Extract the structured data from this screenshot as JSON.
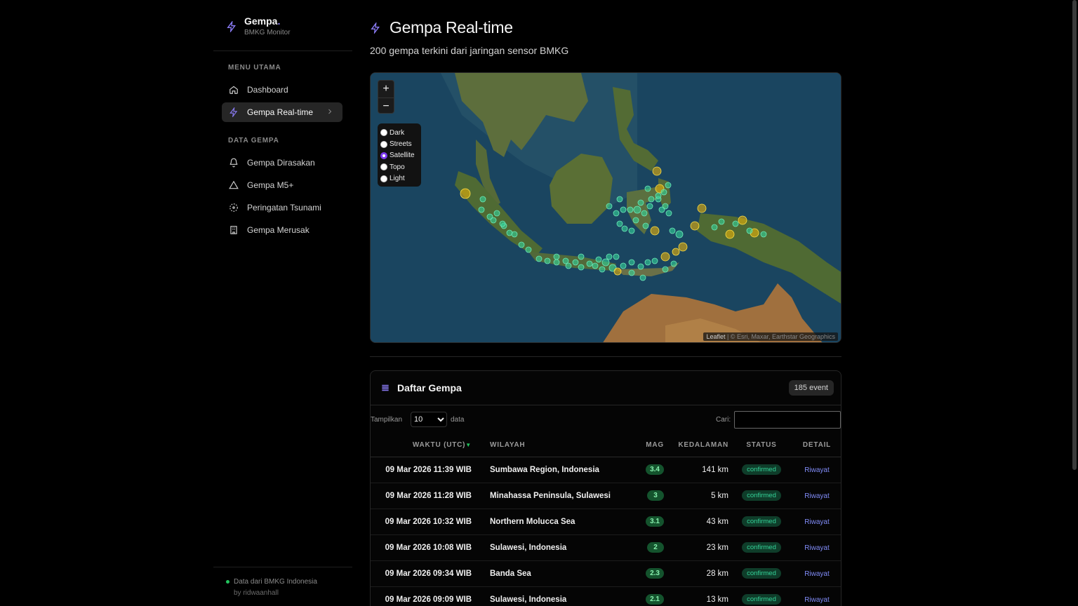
{
  "brand": {
    "title": "Gempa",
    "title_dot": ".",
    "subtitle": "BMKG Monitor"
  },
  "sidebar": {
    "section_main": "MENU UTAMA",
    "section_data": "DATA GEMPA",
    "items": [
      {
        "label": "Dashboard",
        "icon": "home-icon"
      },
      {
        "label": "Gempa Real-time",
        "icon": "bolt-icon",
        "active": true
      },
      {
        "label": "Gempa Dirasakan",
        "icon": "bell-icon"
      },
      {
        "label": "Gempa M5+",
        "icon": "warning-icon"
      },
      {
        "label": "Peringatan Tsunami",
        "icon": "radar-icon"
      },
      {
        "label": "Gempa Merusak",
        "icon": "building-icon"
      }
    ],
    "footer_source": "Data dari BMKG Indonesia",
    "footer_by": "by ridwaanhall"
  },
  "header": {
    "title": "Gempa Real-time",
    "subtitle": "200 gempa terkini dari jaringan sensor BMKG"
  },
  "map": {
    "zoom_in": "+",
    "zoom_out": "−",
    "layers": [
      {
        "label": "Dark",
        "selected": false
      },
      {
        "label": "Streets",
        "selected": false
      },
      {
        "label": "Satellite",
        "selected": true
      },
      {
        "label": "Topo",
        "selected": false
      },
      {
        "label": "Light",
        "selected": false
      }
    ],
    "attribution_leaflet": "Leaflet",
    "attribution_rest": " | © Esri, Maxar, Earthstar Geographics"
  },
  "table_card": {
    "title": "Daftar Gempa",
    "count_badge": "185 event",
    "show_label": "Tampilkan",
    "page_size": "10",
    "page_size_options": [
      "10"
    ],
    "data_label": "data",
    "search_label": "Cari:",
    "search_value": "",
    "columns": [
      "WAKTU (UTC)",
      "WILAYAH",
      "MAG",
      "KEDALAMAN",
      "STATUS",
      "DETAIL"
    ],
    "rows": [
      {
        "time": "09 Mar 2026 11:39 WIB",
        "region": "Sumbawa Region, Indonesia",
        "mag": "3.4",
        "depth": "141 km",
        "status": "confirmed",
        "detail": "Riwayat"
      },
      {
        "time": "09 Mar 2026 11:28 WIB",
        "region": "Minahassa Peninsula, Sulawesi",
        "mag": "3",
        "depth": "5 km",
        "status": "confirmed",
        "detail": "Riwayat"
      },
      {
        "time": "09 Mar 2026 10:32 WIB",
        "region": "Northern Molucca Sea",
        "mag": "3.1",
        "depth": "43 km",
        "status": "confirmed",
        "detail": "Riwayat"
      },
      {
        "time": "09 Mar 2026 10:08 WIB",
        "region": "Sulawesi, Indonesia",
        "mag": "2",
        "depth": "23 km",
        "status": "confirmed",
        "detail": "Riwayat"
      },
      {
        "time": "09 Mar 2026 09:34 WIB",
        "region": "Banda Sea",
        "mag": "2.3",
        "depth": "28 km",
        "status": "confirmed",
        "detail": "Riwayat"
      },
      {
        "time": "09 Mar 2026 09:09 WIB",
        "region": "Sulawesi, Indonesia",
        "mag": "2.1",
        "depth": "13 km",
        "status": "confirmed",
        "detail": "Riwayat"
      }
    ]
  },
  "colors": {
    "accent": "#8b7cf6",
    "quake_small": "#34d399",
    "quake_mid": "#eab308",
    "status_green": "#34d399",
    "link": "#818cf8"
  }
}
